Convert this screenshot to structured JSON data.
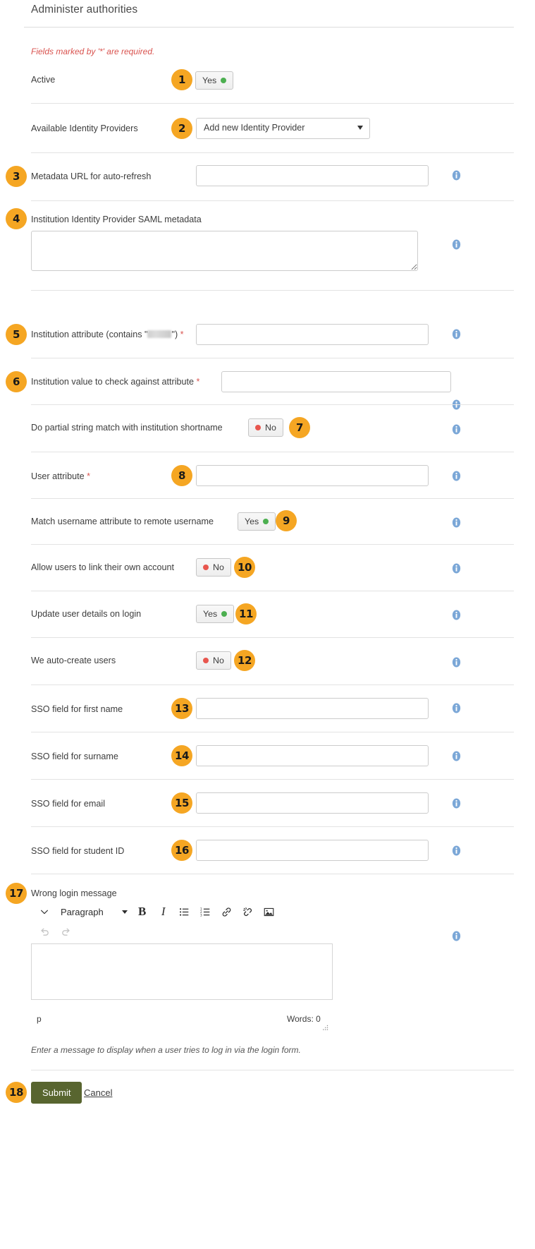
{
  "header": {
    "title": "Administer authorities",
    "required_note": "Fields marked by '*' are required."
  },
  "form": {
    "rows": [
      {
        "n": "1",
        "label": "Active",
        "control": "switch",
        "value": "Yes"
      },
      {
        "n": "2",
        "label": "Available Identity Providers",
        "control": "select",
        "value": "Add new Identity Provider"
      },
      {
        "n": "3",
        "label": "Metadata URL for auto-refresh",
        "control": "text",
        "value": ""
      },
      {
        "n": "4",
        "label": "Institution Identity Provider SAML metadata",
        "control": "textarea",
        "value": ""
      },
      {
        "n": "5",
        "label_pre": "Institution attribute (contains \"",
        "label_post": "\")",
        "required": "*",
        "control": "text",
        "value": "",
        "redacted": true
      },
      {
        "n": "6",
        "label": "Institution value to check against attribute",
        "required": "*",
        "control": "text",
        "value": ""
      },
      {
        "n": "7",
        "label": "Do partial string match with institution shortname",
        "control": "switch",
        "value": "No"
      },
      {
        "n": "8",
        "label": "User attribute",
        "required": "*",
        "control": "text",
        "value": ""
      },
      {
        "n": "9",
        "label": "Match username attribute to remote username",
        "control": "switch",
        "value": "Yes"
      },
      {
        "n": "10",
        "label": "Allow users to link their own account",
        "control": "switch",
        "value": "No"
      },
      {
        "n": "11",
        "label": "Update user details on login",
        "control": "switch",
        "value": "Yes"
      },
      {
        "n": "12",
        "label": "We auto-create users",
        "control": "switch",
        "value": "No"
      },
      {
        "n": "13",
        "label": "SSO field for first name",
        "control": "text",
        "value": ""
      },
      {
        "n": "14",
        "label": "SSO field for surname",
        "control": "text",
        "value": ""
      },
      {
        "n": "15",
        "label": "SSO field for email",
        "control": "text",
        "value": ""
      },
      {
        "n": "16",
        "label": "SSO field for student ID",
        "control": "text",
        "value": ""
      },
      {
        "n": "17",
        "label": "Wrong login message",
        "control": "editor",
        "value": ""
      }
    ]
  },
  "editor": {
    "block_format": "Paragraph",
    "buttons": {
      "bold": "B",
      "italic": "I",
      "bullet_list": "Bulleted list",
      "numbered_list": "Numbered list",
      "link": "Insert link",
      "unlink": "Remove link",
      "image": "Insert image",
      "undo": "Undo",
      "redo": "Redo",
      "toggle": "Toggle toolbar"
    },
    "status_path": "p",
    "word_count": "Words: 0",
    "content": "",
    "helptext": "Enter a message to display when a user tries to log in via the login form."
  },
  "footer": {
    "badge": "18",
    "submit_label": "Submit",
    "cancel_label": "Cancel"
  },
  "colors": {
    "badge_orange": "#f5a623",
    "submit_green": "#58652f",
    "required_red": "#d9534f",
    "info_blue": "#7ba7d7",
    "yes_green": "#4caf50",
    "no_red": "#e8564e"
  },
  "icons": {
    "info": "info-icon",
    "caret": "chevron-down-icon"
  }
}
